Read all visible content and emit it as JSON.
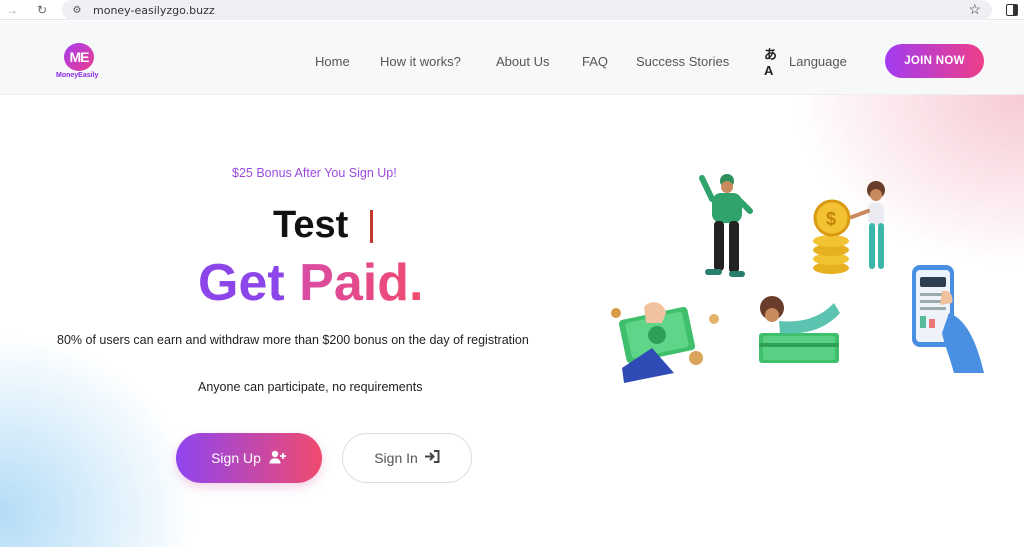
{
  "browser": {
    "url": "money-easilyzgo.buzz",
    "back_icon": "arrow-right-icon",
    "reload_icon": "reload-icon",
    "bookmark_icon": "star-icon"
  },
  "header": {
    "logo_mark": "ME",
    "logo_text": "MoneyEasily",
    "nav": [
      {
        "label": "Home"
      },
      {
        "label": "How it works?"
      },
      {
        "label": "About Us"
      },
      {
        "label": "FAQ"
      },
      {
        "label": "Success Stories"
      }
    ],
    "language_icon_glyph": "あA",
    "language_label": "Language",
    "join_label": "JOIN NOW"
  },
  "hero": {
    "bonus_text": "$25 Bonus After You Sign Up!",
    "headline_line1": "Test",
    "headline_get": "Get",
    "headline_rest": "Paid.",
    "description": "80% of users can earn and withdraw more than $200 bonus on the day of registration",
    "note": "Anyone can participate, no requirements",
    "signup_label": "Sign Up",
    "signin_label": "Sign In"
  },
  "colors": {
    "accent_purple": "#8b45e8",
    "accent_pink": "#f04a6f",
    "bonus_text": "#9b4bdc"
  }
}
